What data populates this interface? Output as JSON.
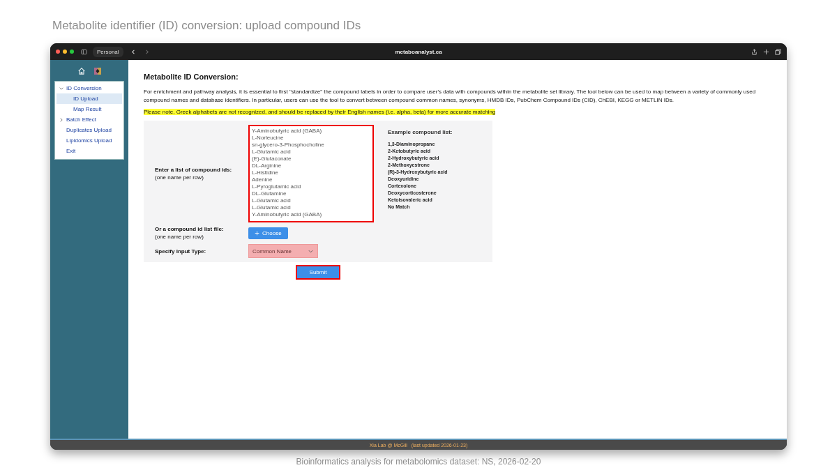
{
  "slide_title": "Metabolite identifier (ID) conversion: upload compound IDs",
  "browser": {
    "profile": "Personal",
    "url": "metaboanalyst.ca"
  },
  "sidebar": {
    "items": [
      {
        "label": "ID Conversion",
        "expanded": true,
        "children": [
          {
            "label": "ID Upload",
            "selected": true
          },
          {
            "label": "Map Result",
            "selected": false
          }
        ]
      },
      {
        "label": "Batch Effect",
        "expanded": false
      },
      {
        "label": "Duplicates Upload"
      },
      {
        "label": "Lipidomics Upload"
      },
      {
        "label": "Exit"
      }
    ]
  },
  "page": {
    "heading": "Metabolite ID Conversion:",
    "intro": "For enrichment and pathway analysis, it is essential to first \"standardize\" the compound labels in order to compare user's data with compounds within the metabolite set library. The tool below can be used to map between a variety of commonly used compound names and database identifiers. In particular, users can use the tool to convert between compound common names, synonyms, HMDB IDs, PubChem Compound IDs (CID), ChEBI, KEGG or METLIN IDs.",
    "note": "Please note, Greek alphabets are not recognized, and should be replaced by their English names (i.e. alpha, beta) for more accurate matching",
    "form": {
      "list_label": "Enter a list of compound ids:",
      "list_hint": "(one name per row)",
      "compound_list": [
        "Y-Aminobutyric acid (GABA)",
        "L-Norleucine",
        "sn-glycero-3-Phosphocholine",
        "L-Glutamic acid",
        "(E)-Glutaconate",
        "DL-Arginine",
        "L-Histidine",
        "Adenine",
        "L-Pyroglutamic acid",
        "DL-Glutamine",
        "L-Glutamic acid",
        "L-Glutamic acid",
        "Y-Aminobutyric acid (GABA)"
      ],
      "example_title": "Example compound list:",
      "examples": [
        "1,3-Diaminopropane",
        "2-Ketobutyric acid",
        "2-Hydroxybutyric acid",
        "2-Methoxyestrone",
        "(R)-3-Hydroxybutyric acid",
        "Deoxyuridine",
        "Cortexolone",
        "Deoxycorticosterone",
        "Ketoisovaleric acid",
        "No Match"
      ],
      "file_label": "Or a compound id list file:",
      "file_hint": "(one name per row)",
      "choose_button": "Choose",
      "type_label": "Specify Input Type:",
      "input_type": "Common Name"
    },
    "submit_button": "Submit"
  },
  "footer": "Xia Lab @ McGill   (last updated 2026-01-23)",
  "caption": "Bioinformatics analysis for metabolomics dataset: NS, 2026-02-20"
}
